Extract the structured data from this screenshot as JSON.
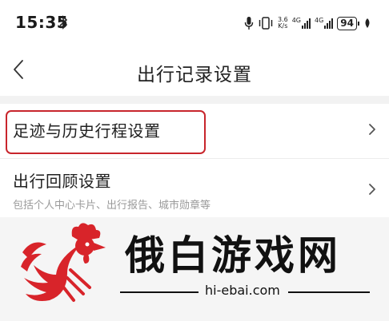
{
  "status_bar": {
    "time": "15:35",
    "speed_value": "3.6",
    "speed_unit": "K/s",
    "network_1": "4G",
    "network_2": "4G",
    "battery": "94"
  },
  "header": {
    "title": "出行记录设置"
  },
  "settings": {
    "items": [
      {
        "title": "足迹与历史行程设置",
        "subtitle": ""
      },
      {
        "title": "出行回顾设置",
        "subtitle": "包括个人中心卡片、出行报告、城市勋章等"
      }
    ]
  },
  "watermark": {
    "title": "俄白游戏网",
    "url": "hi-ebai.com"
  },
  "colors": {
    "highlight": "#c8252c",
    "logo_red": "#d8242a"
  }
}
